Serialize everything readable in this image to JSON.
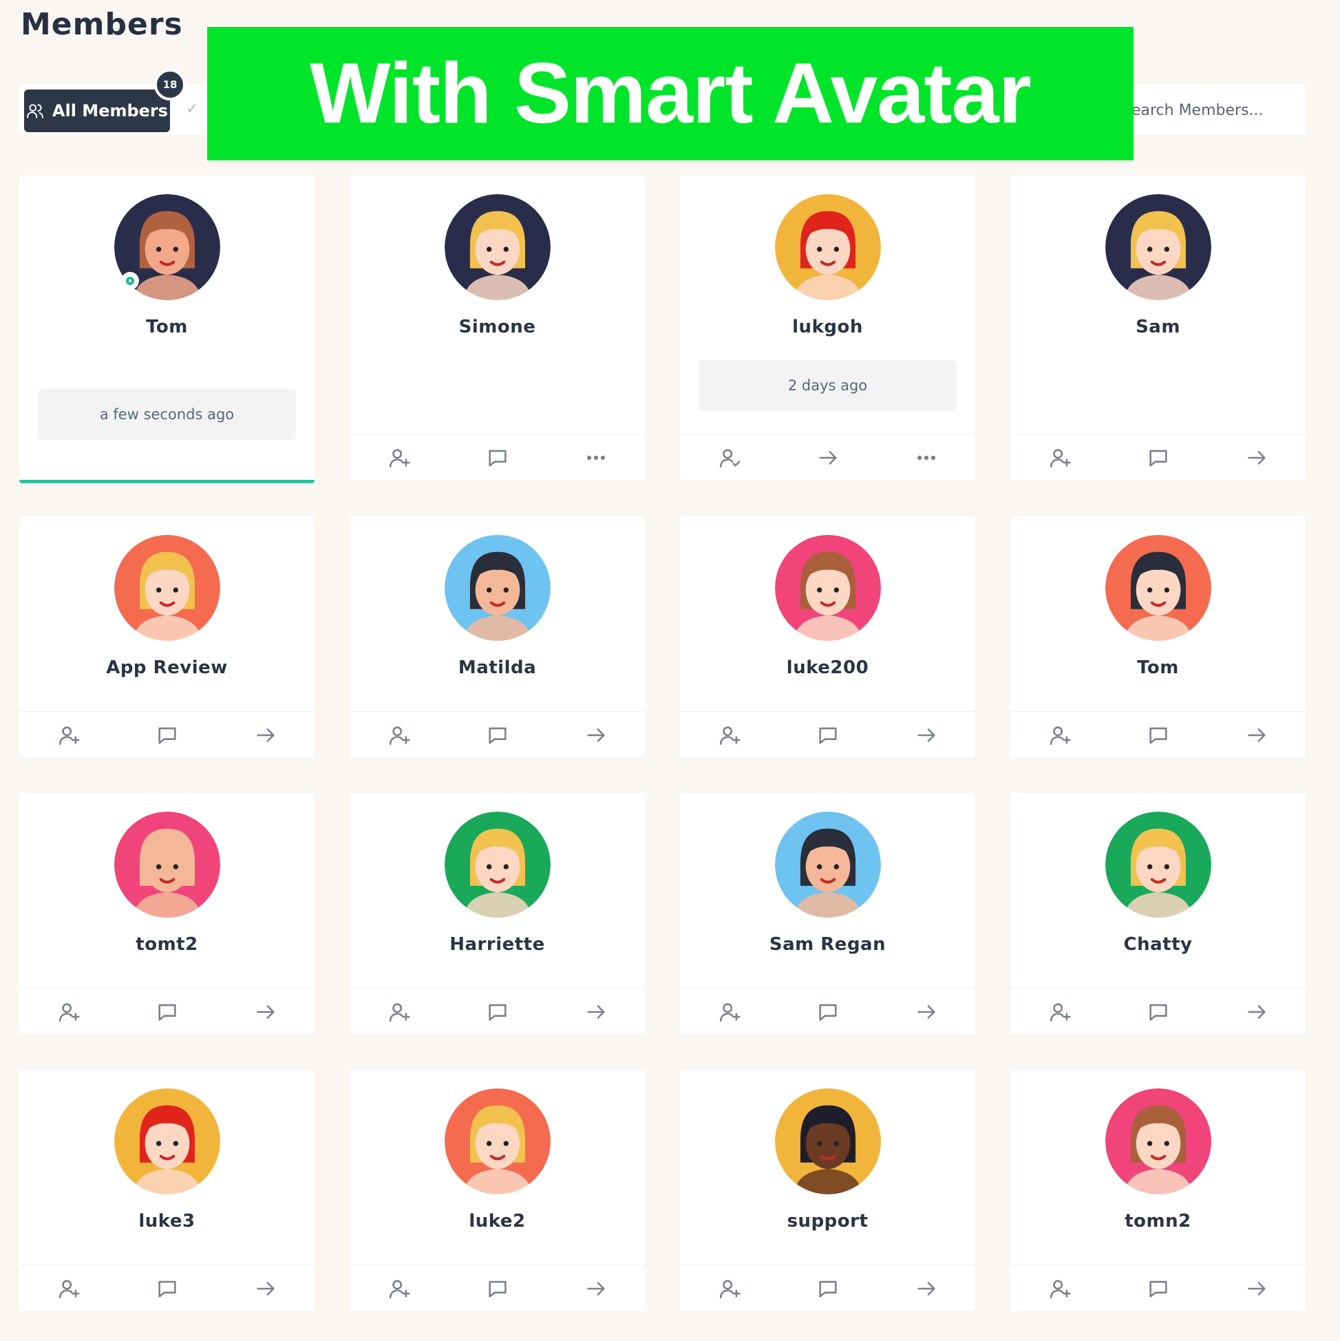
{
  "header": {
    "title": "Members"
  },
  "tabs": {
    "all_label": "All Members",
    "count": "18",
    "check": "✓"
  },
  "search": {
    "placeholder": "Search Members..."
  },
  "banner": {
    "text": "With Smart Avatar"
  },
  "members": [
    {
      "name": "Tom",
      "status": "a few seconds ago",
      "online": true,
      "active": true,
      "bg": "#2a2d4a",
      "hair": "#b0623f",
      "skin": "#f4a88a",
      "actions": []
    },
    {
      "name": "Simone",
      "status": "",
      "bg": "#2a2d4a",
      "hair": "#f2c14e",
      "skin": "#fbd7c4",
      "actions": [
        "add-friend-icon",
        "message-icon",
        "more-icon"
      ]
    },
    {
      "name": "lukgoh",
      "status": "2 days ago",
      "bg": "#f2b53c",
      "hair": "#e0241c",
      "skin": "#fbd7c4",
      "actions": [
        "friend-check-icon",
        "arrow-right-icon",
        "more-icon"
      ]
    },
    {
      "name": "Sam",
      "status": "",
      "bg": "#2a2d4a",
      "hair": "#f2c14e",
      "skin": "#fbd7c4",
      "actions": [
        "add-friend-icon",
        "message-icon",
        "arrow-right-icon"
      ]
    },
    {
      "name": "App Review",
      "status": "",
      "bg": "#f46b4f",
      "hair": "#f2c14e",
      "skin": "#fbd7c4",
      "actions": [
        "add-friend-icon",
        "message-icon",
        "arrow-right-icon"
      ]
    },
    {
      "name": "Matilda",
      "status": "",
      "bg": "#6ec3f0",
      "hair": "#2a2d3a",
      "skin": "#f4b898",
      "actions": [
        "add-friend-icon",
        "message-icon",
        "arrow-right-icon"
      ]
    },
    {
      "name": "luke200",
      "status": "",
      "bg": "#f0447a",
      "hair": "#a9603a",
      "skin": "#fbd7c4",
      "actions": [
        "add-friend-icon",
        "message-icon",
        "arrow-right-icon"
      ]
    },
    {
      "name": "Tom",
      "status": "",
      "bg": "#f46b4f",
      "hair": "#2a2d3a",
      "skin": "#fbd7c4",
      "actions": [
        "add-friend-icon",
        "message-icon",
        "arrow-right-icon"
      ]
    },
    {
      "name": "tomt2",
      "status": "",
      "bg": "#f0447a",
      "hair": "#f4b898",
      "skin": "#f4b898",
      "actions": [
        "add-friend-icon",
        "message-icon",
        "arrow-right-icon"
      ]
    },
    {
      "name": "Harriette",
      "status": "",
      "bg": "#1aa85a",
      "hair": "#f2c14e",
      "skin": "#fbd7c4",
      "actions": [
        "add-friend-icon",
        "message-icon",
        "arrow-right-icon"
      ]
    },
    {
      "name": "Sam Regan",
      "status": "",
      "bg": "#6ec3f0",
      "hair": "#2a2d3a",
      "skin": "#f4b898",
      "actions": [
        "add-friend-icon",
        "message-icon",
        "arrow-right-icon"
      ]
    },
    {
      "name": "Chatty",
      "status": "",
      "bg": "#1aa85a",
      "hair": "#f2c14e",
      "skin": "#fbd7c4",
      "actions": [
        "add-friend-icon",
        "message-icon",
        "arrow-right-icon"
      ]
    },
    {
      "name": "luke3",
      "status": "",
      "bg": "#f2b53c",
      "hair": "#e0241c",
      "skin": "#fbd7c4",
      "actions": [
        "add-friend-icon",
        "message-icon",
        "arrow-right-icon"
      ]
    },
    {
      "name": "luke2",
      "status": "",
      "bg": "#f46b4f",
      "hair": "#f2c14e",
      "skin": "#fbd7c4",
      "actions": [
        "add-friend-icon",
        "message-icon",
        "arrow-right-icon"
      ]
    },
    {
      "name": "support",
      "status": "",
      "bg": "#f2b53c",
      "hair": "#1e1e2a",
      "skin": "#6b3a22",
      "actions": [
        "add-friend-icon",
        "message-icon",
        "arrow-right-icon"
      ]
    },
    {
      "name": "tomn2",
      "status": "",
      "bg": "#f0447a",
      "hair": "#a9603a",
      "skin": "#fbd7c4",
      "actions": [
        "add-friend-icon",
        "message-icon",
        "arrow-right-icon"
      ]
    }
  ]
}
